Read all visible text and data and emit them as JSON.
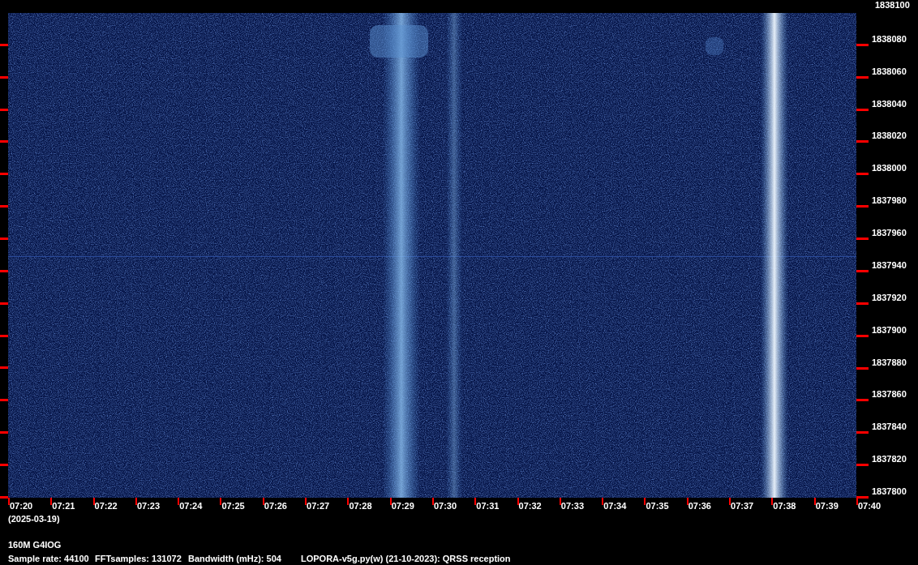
{
  "frequency_axis": [
    "1838100",
    "1838080",
    "1838060",
    "1838040",
    "1838020",
    "1838000",
    "1837980",
    "1837960",
    "1837940",
    "1837920",
    "1837900",
    "1837880",
    "1837860",
    "1837840",
    "1837820",
    "1837800"
  ],
  "time_axis": [
    "07:20",
    "07:21",
    "07:22",
    "07:23",
    "07:24",
    "07:25",
    "07:26",
    "07:27",
    "07:28",
    "07:29",
    "07:30",
    "07:31",
    "07:32",
    "07:33",
    "07:34",
    "07:35",
    "07:36",
    "07:37",
    "07:38",
    "07:39",
    "07:40"
  ],
  "date": "(2025-03-19)",
  "station": "160M G4IOG",
  "info": [
    "Sample rate: 44100",
    "FFTsamples: 131072",
    "Bandwidth (mHz): 504",
    "LOPORA-v5g.py(w) (21-10-2023): QRSS reception"
  ]
}
